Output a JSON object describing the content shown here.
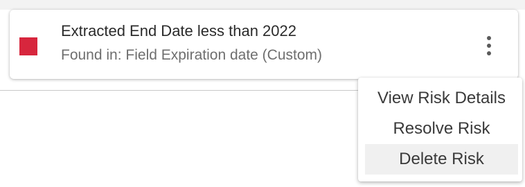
{
  "risk_card": {
    "title": "Extracted End Date less than 2022",
    "subtitle": "Found in: Field Expiration date (Custom)",
    "severity_color": "#d7263d",
    "menu_icon": "vertical-ellipsis-icon"
  },
  "context_menu": {
    "items": [
      {
        "label": "View Risk Details",
        "highlighted": false
      },
      {
        "label": "Resolve Risk",
        "highlighted": false
      },
      {
        "label": "Delete Risk",
        "highlighted": true
      }
    ]
  }
}
